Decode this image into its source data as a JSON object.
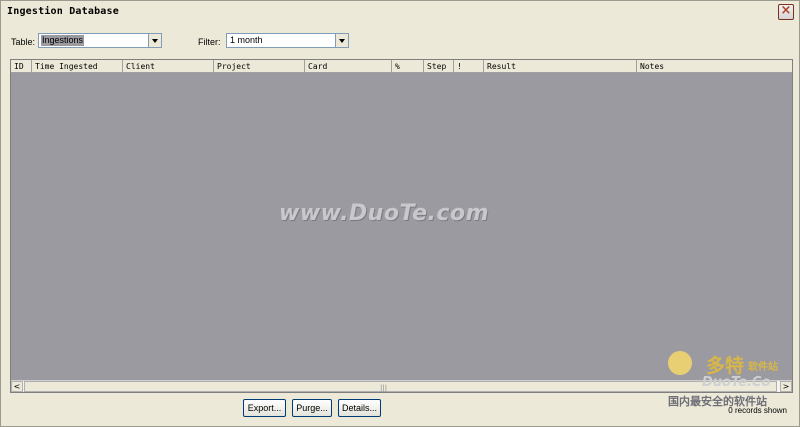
{
  "window": {
    "title": "Ingestion Database",
    "close_label": "×"
  },
  "controls": {
    "table_label": "Table:",
    "table_value": "Ingestions",
    "filter_label": "Filter:",
    "filter_value": "1 month"
  },
  "grid": {
    "columns": [
      "ID",
      "Time Ingested",
      "Client",
      "Project",
      "Card",
      "%",
      "Step",
      "!",
      "Result",
      "Notes"
    ],
    "rows": []
  },
  "scrollbar": {
    "left_arrow": "<",
    "right_arrow": ">",
    "grip": "|||"
  },
  "buttons": {
    "export": "Export...",
    "purge": "Purge...",
    "details": "Details..."
  },
  "status": {
    "records": "0 records shown"
  },
  "watermark": {
    "text": "www.DuoTe.com"
  },
  "logo": {
    "line1": "多特",
    "line2": "软件站",
    "line3": "DuoTe.Co",
    "line4": "国内最安全的软件站"
  },
  "colors": {
    "window_bg": "#ece9d8",
    "grid_bg": "#9b9aa0",
    "selection": "#9b9aa0",
    "border_accent": "#7f9db9"
  }
}
